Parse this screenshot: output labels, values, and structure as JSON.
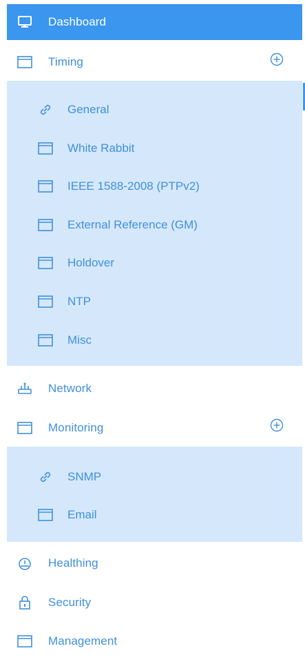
{
  "colors": {
    "active_bg": "#3a96ee",
    "submenu_bg": "#d5e8fb",
    "text": "#3f8fdd",
    "active_text": "#ffffff"
  },
  "menu": {
    "dashboard": {
      "label": "Dashboard",
      "icon": "monitor-icon"
    },
    "timing": {
      "label": "Timing",
      "icon": "window-icon",
      "expand_icon": "plus-circle-icon",
      "children": [
        {
          "label": "General",
          "icon": "link-icon"
        },
        {
          "label": "White Rabbit",
          "icon": "window-icon"
        },
        {
          "label": "IEEE 1588-2008 (PTPv2)",
          "icon": "window-icon"
        },
        {
          "label": "External Reference (GM)",
          "icon": "window-icon"
        },
        {
          "label": "Holdover",
          "icon": "window-icon"
        },
        {
          "label": "NTP",
          "icon": "window-icon"
        },
        {
          "label": "Misc",
          "icon": "window-icon"
        }
      ]
    },
    "network": {
      "label": "Network",
      "icon": "network-icon"
    },
    "monitoring": {
      "label": "Monitoring",
      "icon": "window-icon",
      "expand_icon": "plus-circle-icon",
      "children": [
        {
          "label": "SNMP",
          "icon": "link-icon"
        },
        {
          "label": "Email",
          "icon": "window-icon"
        }
      ]
    },
    "healthing": {
      "label": "Healthing",
      "icon": "gauge-icon"
    },
    "security": {
      "label": "Security",
      "icon": "lock-icon"
    },
    "management": {
      "label": "Management",
      "icon": "window-icon"
    }
  }
}
